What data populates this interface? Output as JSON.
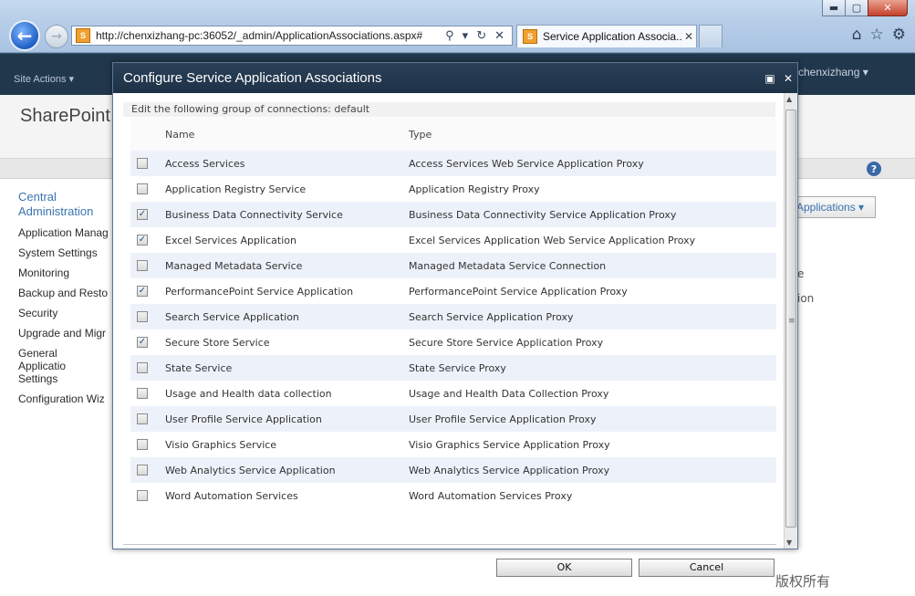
{
  "browser": {
    "window_title": "",
    "address_url": "http://chenxizhang-pc:36052/_admin/ApplicationAssociations.aspx#",
    "tab_label": "Service Application Associa...",
    "win_controls": {
      "minimize": "▬",
      "maximize": "▢",
      "close": "✕"
    }
  },
  "sharepoint": {
    "site_actions": "Site Actions ▾",
    "user": "chenxizhang ▾",
    "logo": "SharePoint",
    "quick_launch": {
      "heading": "Central Administration",
      "items": [
        "Application Manag",
        "System Settings",
        "Monitoring",
        "Backup and Resto",
        "Security",
        "Upgrade and Migr",
        "General Applicatio Settings",
        "Configuration Wiz"
      ]
    },
    "bg_button": "Applications ▾",
    "bg_fragment_1": "e",
    "bg_fragment_2": "ion"
  },
  "dialog": {
    "title": "Configure Service Application Associations",
    "instruction": "Edit the following group of connections: default",
    "columns": {
      "name": "Name",
      "type": "Type"
    },
    "rows": [
      {
        "checked": false,
        "name": "Access Services",
        "type": "Access Services Web Service Application Proxy"
      },
      {
        "checked": false,
        "name": "Application Registry Service",
        "type": "Application Registry Proxy"
      },
      {
        "checked": true,
        "name": "Business Data Connectivity Service",
        "type": "Business Data Connectivity Service Application Proxy"
      },
      {
        "checked": true,
        "name": "Excel Services Application",
        "type": "Excel Services Application Web Service Application Proxy"
      },
      {
        "checked": false,
        "name": "Managed Metadata Service",
        "type": "Managed Metadata Service Connection"
      },
      {
        "checked": true,
        "name": "PerformancePoint Service Application",
        "type": "PerformancePoint Service Application Proxy"
      },
      {
        "checked": false,
        "name": "Search Service Application",
        "type": "Search Service Application Proxy"
      },
      {
        "checked": true,
        "name": "Secure Store Service",
        "type": "Secure Store Service Application Proxy"
      },
      {
        "checked": false,
        "name": "State Service",
        "type": "State Service Proxy"
      },
      {
        "checked": false,
        "name": "Usage and Health data collection",
        "type": "Usage and Health Data Collection Proxy"
      },
      {
        "checked": false,
        "name": "User Profile Service Application",
        "type": "User Profile Service Application Proxy"
      },
      {
        "checked": false,
        "name": "Visio Graphics Service",
        "type": "Visio Graphics Service Application Proxy"
      },
      {
        "checked": false,
        "name": "Web Analytics Service Application",
        "type": "Web Analytics Service Application Proxy"
      },
      {
        "checked": false,
        "name": "Word Automation Services",
        "type": "Word Automation Services Proxy"
      }
    ],
    "ok_label": "OK",
    "cancel_label": "Cancel"
  },
  "watermark": "版权所有"
}
